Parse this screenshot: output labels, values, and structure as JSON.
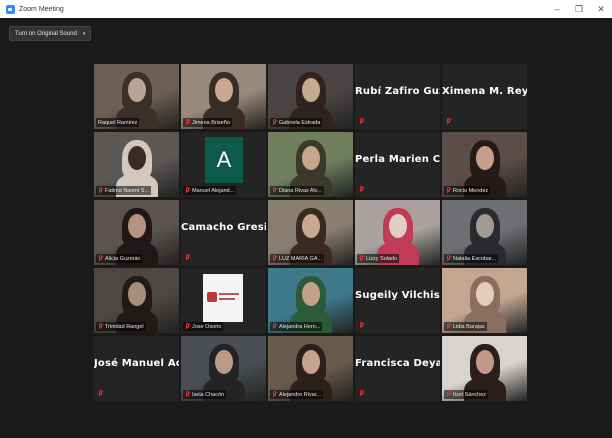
{
  "window": {
    "title": "Zoom Meeting",
    "controls": {
      "minimize": "–",
      "maximize": "❐",
      "close": "✕"
    }
  },
  "toolbar": {
    "original_sound_label": "Turn on Original Sound",
    "dropdown_icon": "chevron-down-icon"
  },
  "participants": [
    {
      "name": "Raquel Ramirez",
      "kind": "video",
      "muted": false,
      "active": true,
      "palette": [
        "#6d6054",
        "#3b2f2a",
        "#b8a596"
      ]
    },
    {
      "name": "Jimena Briseño",
      "kind": "video",
      "muted": true,
      "palette": [
        "#9a8a7c",
        "#3a2c27",
        "#c9a894"
      ]
    },
    {
      "name": "Gabriela Estrada",
      "kind": "video",
      "muted": true,
      "palette": [
        "#4a4544",
        "#2e2321",
        "#c7a98f"
      ]
    },
    {
      "name": "Rubí Zafiro Guz...",
      "kind": "name",
      "muted": true
    },
    {
      "name": "Ximena M. Rey...",
      "kind": "name",
      "muted": true
    },
    {
      "name": "Fatima Naomi S...",
      "kind": "video",
      "muted": true,
      "palette": [
        "#5b5856",
        "#d4c7bd",
        "#3c2a26"
      ]
    },
    {
      "name": "Manuel Alejand...",
      "kind": "avatar",
      "avatar_letter": "A",
      "muted": true
    },
    {
      "name": "Diana Rivas Alv...",
      "kind": "video",
      "muted": true,
      "palette": [
        "#6f7e5c",
        "#3b3a2a",
        "#c6a78a"
      ]
    },
    {
      "name": "Perla Marien Ca...",
      "kind": "name",
      "muted": true
    },
    {
      "name": "Rocio Mendez",
      "kind": "video",
      "muted": true,
      "palette": [
        "#5a4d4a",
        "#241a18",
        "#c59f8b"
      ]
    },
    {
      "name": "Alicia Guzmán",
      "kind": "video",
      "muted": true,
      "palette": [
        "#5b5350",
        "#201818",
        "#b79280"
      ]
    },
    {
      "name": "Camacho Gresia...",
      "kind": "name",
      "muted": true
    },
    {
      "name": "LUZ MARIA GA...",
      "kind": "video",
      "muted": true,
      "palette": [
        "#8a7f6f",
        "#3a2a22",
        "#caa892"
      ]
    },
    {
      "name": "Lizzy Solado",
      "kind": "video",
      "muted": true,
      "palette": [
        "#a9a2a0",
        "#c23b55",
        "#e2cfc4"
      ]
    },
    {
      "name": "Natalia Escobar...",
      "kind": "video",
      "muted": true,
      "palette": [
        "#6e6f72",
        "#2a2b2e",
        "#a49a92"
      ]
    },
    {
      "name": "Trinidad Rangel",
      "kind": "video",
      "muted": true,
      "palette": [
        "#4d4744",
        "#201a18",
        "#a88d7a"
      ]
    },
    {
      "name": "Jose Osorio",
      "kind": "logo",
      "muted": true
    },
    {
      "name": "Alejandra Hern...",
      "kind": "video",
      "muted": true,
      "palette": [
        "#3e7a8c",
        "#2c5b3a",
        "#c6a18a"
      ]
    },
    {
      "name": "Sugeily Vilchis...",
      "kind": "name",
      "muted": true
    },
    {
      "name": "Lidia Barajas",
      "kind": "video",
      "muted": true,
      "palette": [
        "#c4a791",
        "#8a6f5e",
        "#e4cdb9"
      ]
    },
    {
      "name": "José Manuel Ac...",
      "kind": "name",
      "muted": true
    },
    {
      "name": "Isela Chacón",
      "kind": "video",
      "muted": true,
      "palette": [
        "#4a4e52",
        "#222426",
        "#bf9a86"
      ]
    },
    {
      "name": "Alejandro Rivar...",
      "kind": "video",
      "muted": true,
      "palette": [
        "#6a5a4c",
        "#2b201a",
        "#c7a38d"
      ]
    },
    {
      "name": "Francisca Deya...",
      "kind": "name",
      "muted": true
    },
    {
      "name": "Itzel Sánchez",
      "kind": "video",
      "muted": true,
      "palette": [
        "#d9d4cf",
        "#2a1f1c",
        "#c09a86"
      ]
    }
  ]
}
